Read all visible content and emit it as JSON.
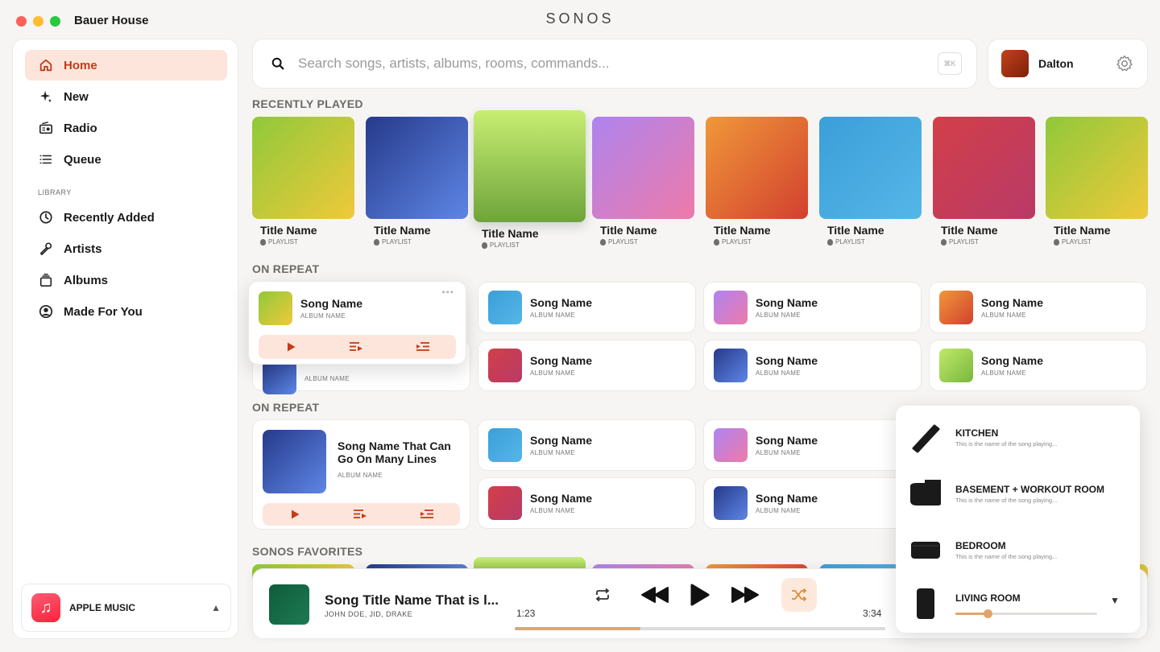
{
  "window": {
    "house_name": "Bauer House",
    "brand": "SONOS"
  },
  "sidebar": {
    "items": [
      {
        "label": "Home",
        "icon": "home-icon",
        "active": true
      },
      {
        "label": "New",
        "icon": "sparkle-icon"
      },
      {
        "label": "Radio",
        "icon": "radio-icon"
      },
      {
        "label": "Queue",
        "icon": "queue-icon"
      }
    ],
    "library_heading": "LIBRARY",
    "library_items": [
      {
        "label": "Recently Added",
        "icon": "clock-icon"
      },
      {
        "label": "Artists",
        "icon": "microphone-icon"
      },
      {
        "label": "Albums",
        "icon": "albums-icon"
      },
      {
        "label": "Made For You",
        "icon": "user-circle-icon"
      }
    ],
    "service": {
      "label": "APPLE MUSIC",
      "icon": "apple-music-icon"
    }
  },
  "search": {
    "placeholder": "Search songs, artists, albums, rooms, commands...",
    "shortcut": "⌘K"
  },
  "profile": {
    "name": "Dalton"
  },
  "sections": {
    "recently_played": "RECENTLY PLAYED",
    "on_repeat_1": "ON REPEAT",
    "on_repeat_2": "ON REPEAT",
    "sonos_favorites": "SONOS FAVORITES"
  },
  "recently_played": [
    {
      "title": "Title Name",
      "sub": "PLAYLIST"
    },
    {
      "title": "Title Name",
      "sub": "PLAYLIST"
    },
    {
      "title": "Title Name",
      "sub": "PLAYLIST"
    },
    {
      "title": "Title Name",
      "sub": "PLAYLIST"
    },
    {
      "title": "Title Name",
      "sub": "PLAYLIST"
    },
    {
      "title": "Title Name",
      "sub": "PLAYLIST"
    },
    {
      "title": "Title Name",
      "sub": "PLAYLIST"
    },
    {
      "title": "Title Name",
      "sub": "PLAYLIST"
    }
  ],
  "on_repeat": {
    "expanded": {
      "name": "Song Name",
      "album": "ALBUM NAME"
    },
    "hidden_album": "ALBUM NAME",
    "cards": [
      {
        "name": "Song Name",
        "album": "ALBUM NAME"
      },
      {
        "name": "Song Name",
        "album": "ALBUM NAME"
      },
      {
        "name": "Song Name",
        "album": "ALBUM NAME"
      },
      {
        "name": "Song Name",
        "album": "ALBUM NAME"
      },
      {
        "name": "Song Name",
        "album": "ALBUM NAME"
      },
      {
        "name": "Song Name",
        "album": "ALBUM NAME"
      }
    ]
  },
  "on_repeat_2": {
    "big": {
      "title_line1": "Song Name That Can",
      "title_line2": "Go On Many Lines",
      "album": "ALBUM NAME"
    },
    "cards": [
      {
        "name": "Song Name",
        "album": "ALBUM NAME"
      },
      {
        "name": "Song Name",
        "album": "ALBUM NAME"
      },
      {
        "name": "Song Name",
        "album": "ALBUM NAME"
      },
      {
        "name": "Song Name",
        "album": "ALBUM NAME"
      }
    ]
  },
  "player": {
    "title": "Song Title Name That is l...",
    "artists": "JOHN DOE, JID, DRAKE",
    "elapsed": "1:23",
    "duration": "3:34",
    "progress": 0.34,
    "shuffle_on": true
  },
  "rooms": [
    {
      "name": "KITCHEN",
      "now_playing": "This is the name of the song playing..."
    },
    {
      "name": "BASEMENT + WORKOUT ROOM",
      "now_playing": "This is the name of the song playing..."
    },
    {
      "name": "BEDROOM",
      "now_playing": "This is the name of the song playing..."
    },
    {
      "name": "LIVING ROOM",
      "volume": 0.23
    }
  ],
  "colors": {
    "accent": "#c23c17",
    "accent_soft": "#fde5dc",
    "progress": "#e3a46a"
  }
}
